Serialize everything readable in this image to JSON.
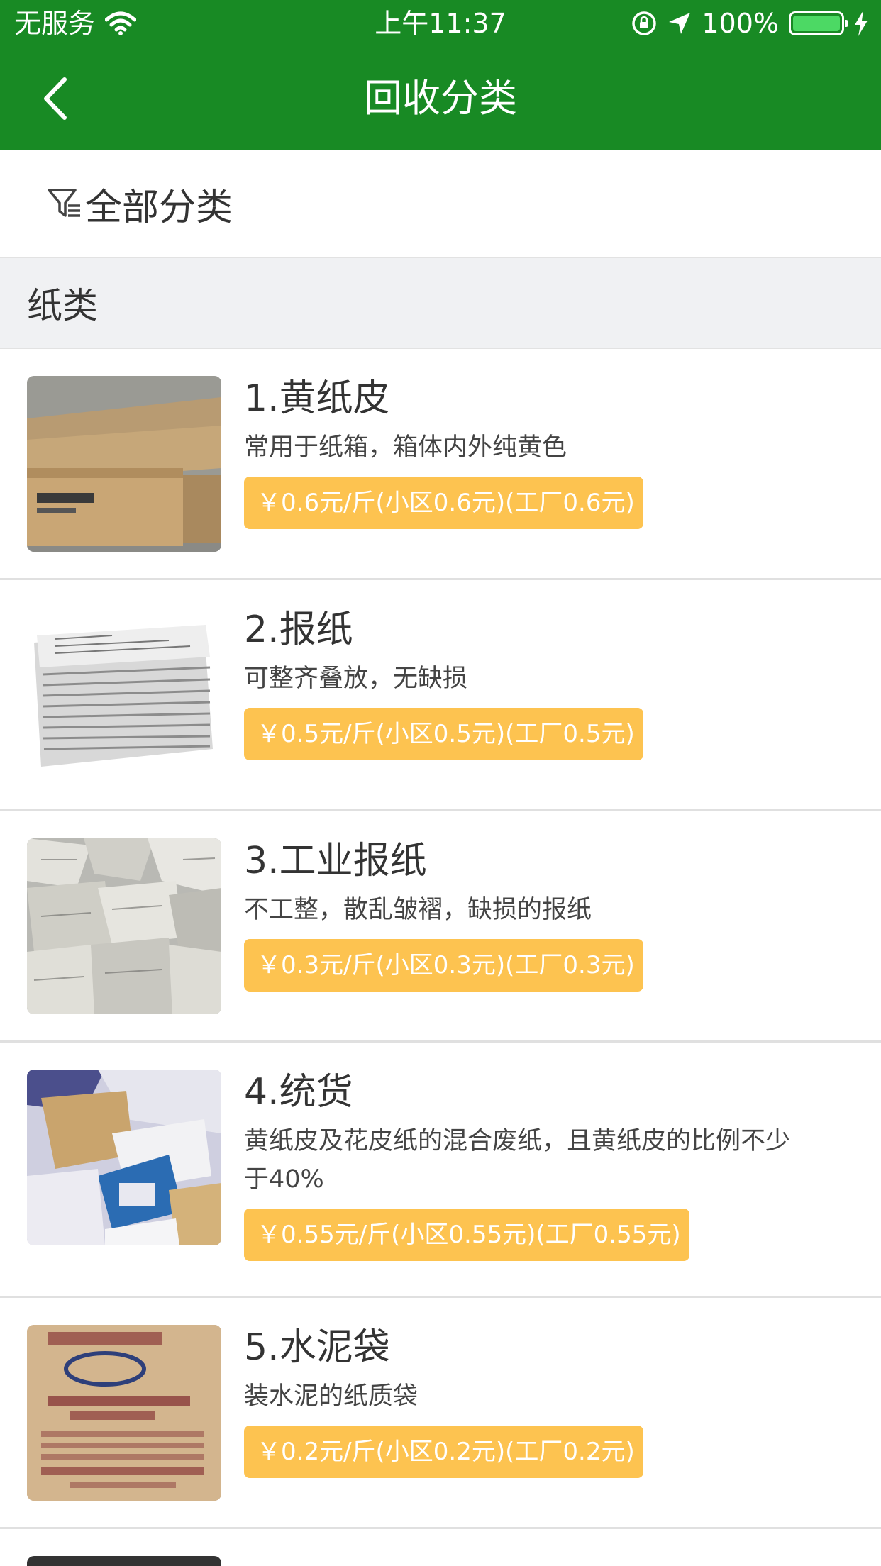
{
  "status_bar": {
    "carrier": "无服务",
    "time": "上午11:37",
    "battery": "100%"
  },
  "nav": {
    "title": "回收分类"
  },
  "filter": {
    "label": "全部分类"
  },
  "section": {
    "title": "纸类"
  },
  "items": [
    {
      "title": "1.黄纸皮",
      "desc": "常用于纸箱，箱体内外纯黄色",
      "price": "￥0.6元/斤(小区0.6元)(工厂0.6元)"
    },
    {
      "title": "2.报纸",
      "desc": "可整齐叠放，无缺损",
      "price": "￥0.5元/斤(小区0.5元)(工厂0.5元)"
    },
    {
      "title": "3.工业报纸",
      "desc": "不工整，散乱皱褶，缺损的报纸",
      "price": "￥0.3元/斤(小区0.3元)(工厂0.3元)"
    },
    {
      "title": "4.统货",
      "desc": "黄纸皮及花皮纸的混合废纸，且黄纸皮的比例不少于40%",
      "price": "￥0.55元/斤(小区0.55元)(工厂0.55元)"
    },
    {
      "title": "5.水泥袋",
      "desc": "装水泥的纸质袋",
      "price": "￥0.2元/斤(小区0.2元)(工厂0.2元)"
    }
  ],
  "colors": {
    "brand_green": "#188a24",
    "price_badge": "#fdc350",
    "section_bg": "#f0f1f3"
  }
}
